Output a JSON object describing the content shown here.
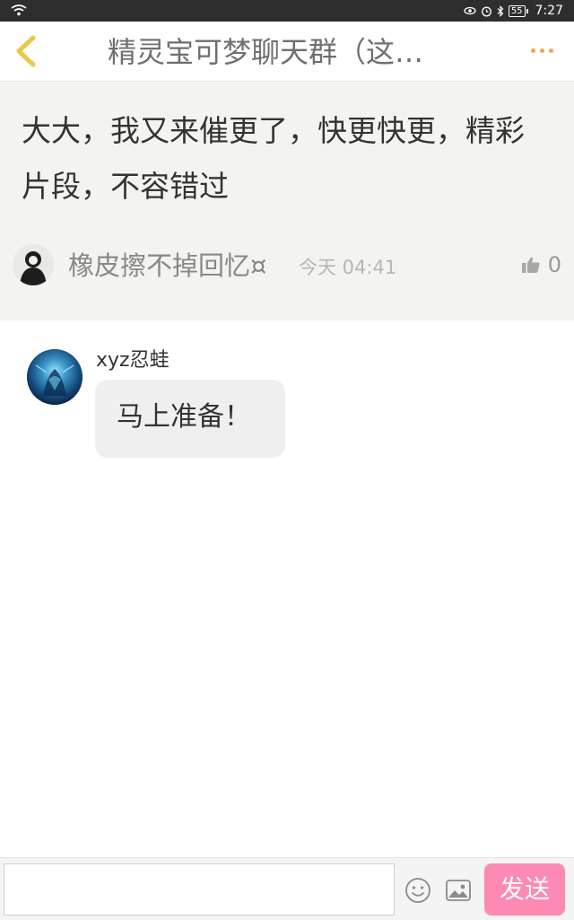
{
  "status_bar": {
    "battery": "55",
    "time": "7:27",
    "icons": [
      "wifi-icon",
      "eye-icon",
      "alarm-icon",
      "bluetooth-icon",
      "battery-icon"
    ]
  },
  "header": {
    "title": "精灵宝可梦聊天群（这…",
    "back_icon": "chevron-left-icon",
    "more_icon": "more-dots-icon",
    "accent_back": "#e9c84d",
    "accent_more": "#f3a356"
  },
  "topic": {
    "text": "大大，我又来催更了，快更快更，精彩片段，不容错过",
    "author": "橡皮擦不掉回忆¤",
    "time": "今天 04:41",
    "likes": "0",
    "background": "#f3f3ef"
  },
  "messages": [
    {
      "name": "xyz忍蛙",
      "text": "马上准备！"
    }
  ],
  "input_bar": {
    "placeholder": "",
    "send_label": "发送",
    "send_color": "#fd8ab2",
    "icons": [
      "emoji-icon",
      "image-icon"
    ]
  }
}
